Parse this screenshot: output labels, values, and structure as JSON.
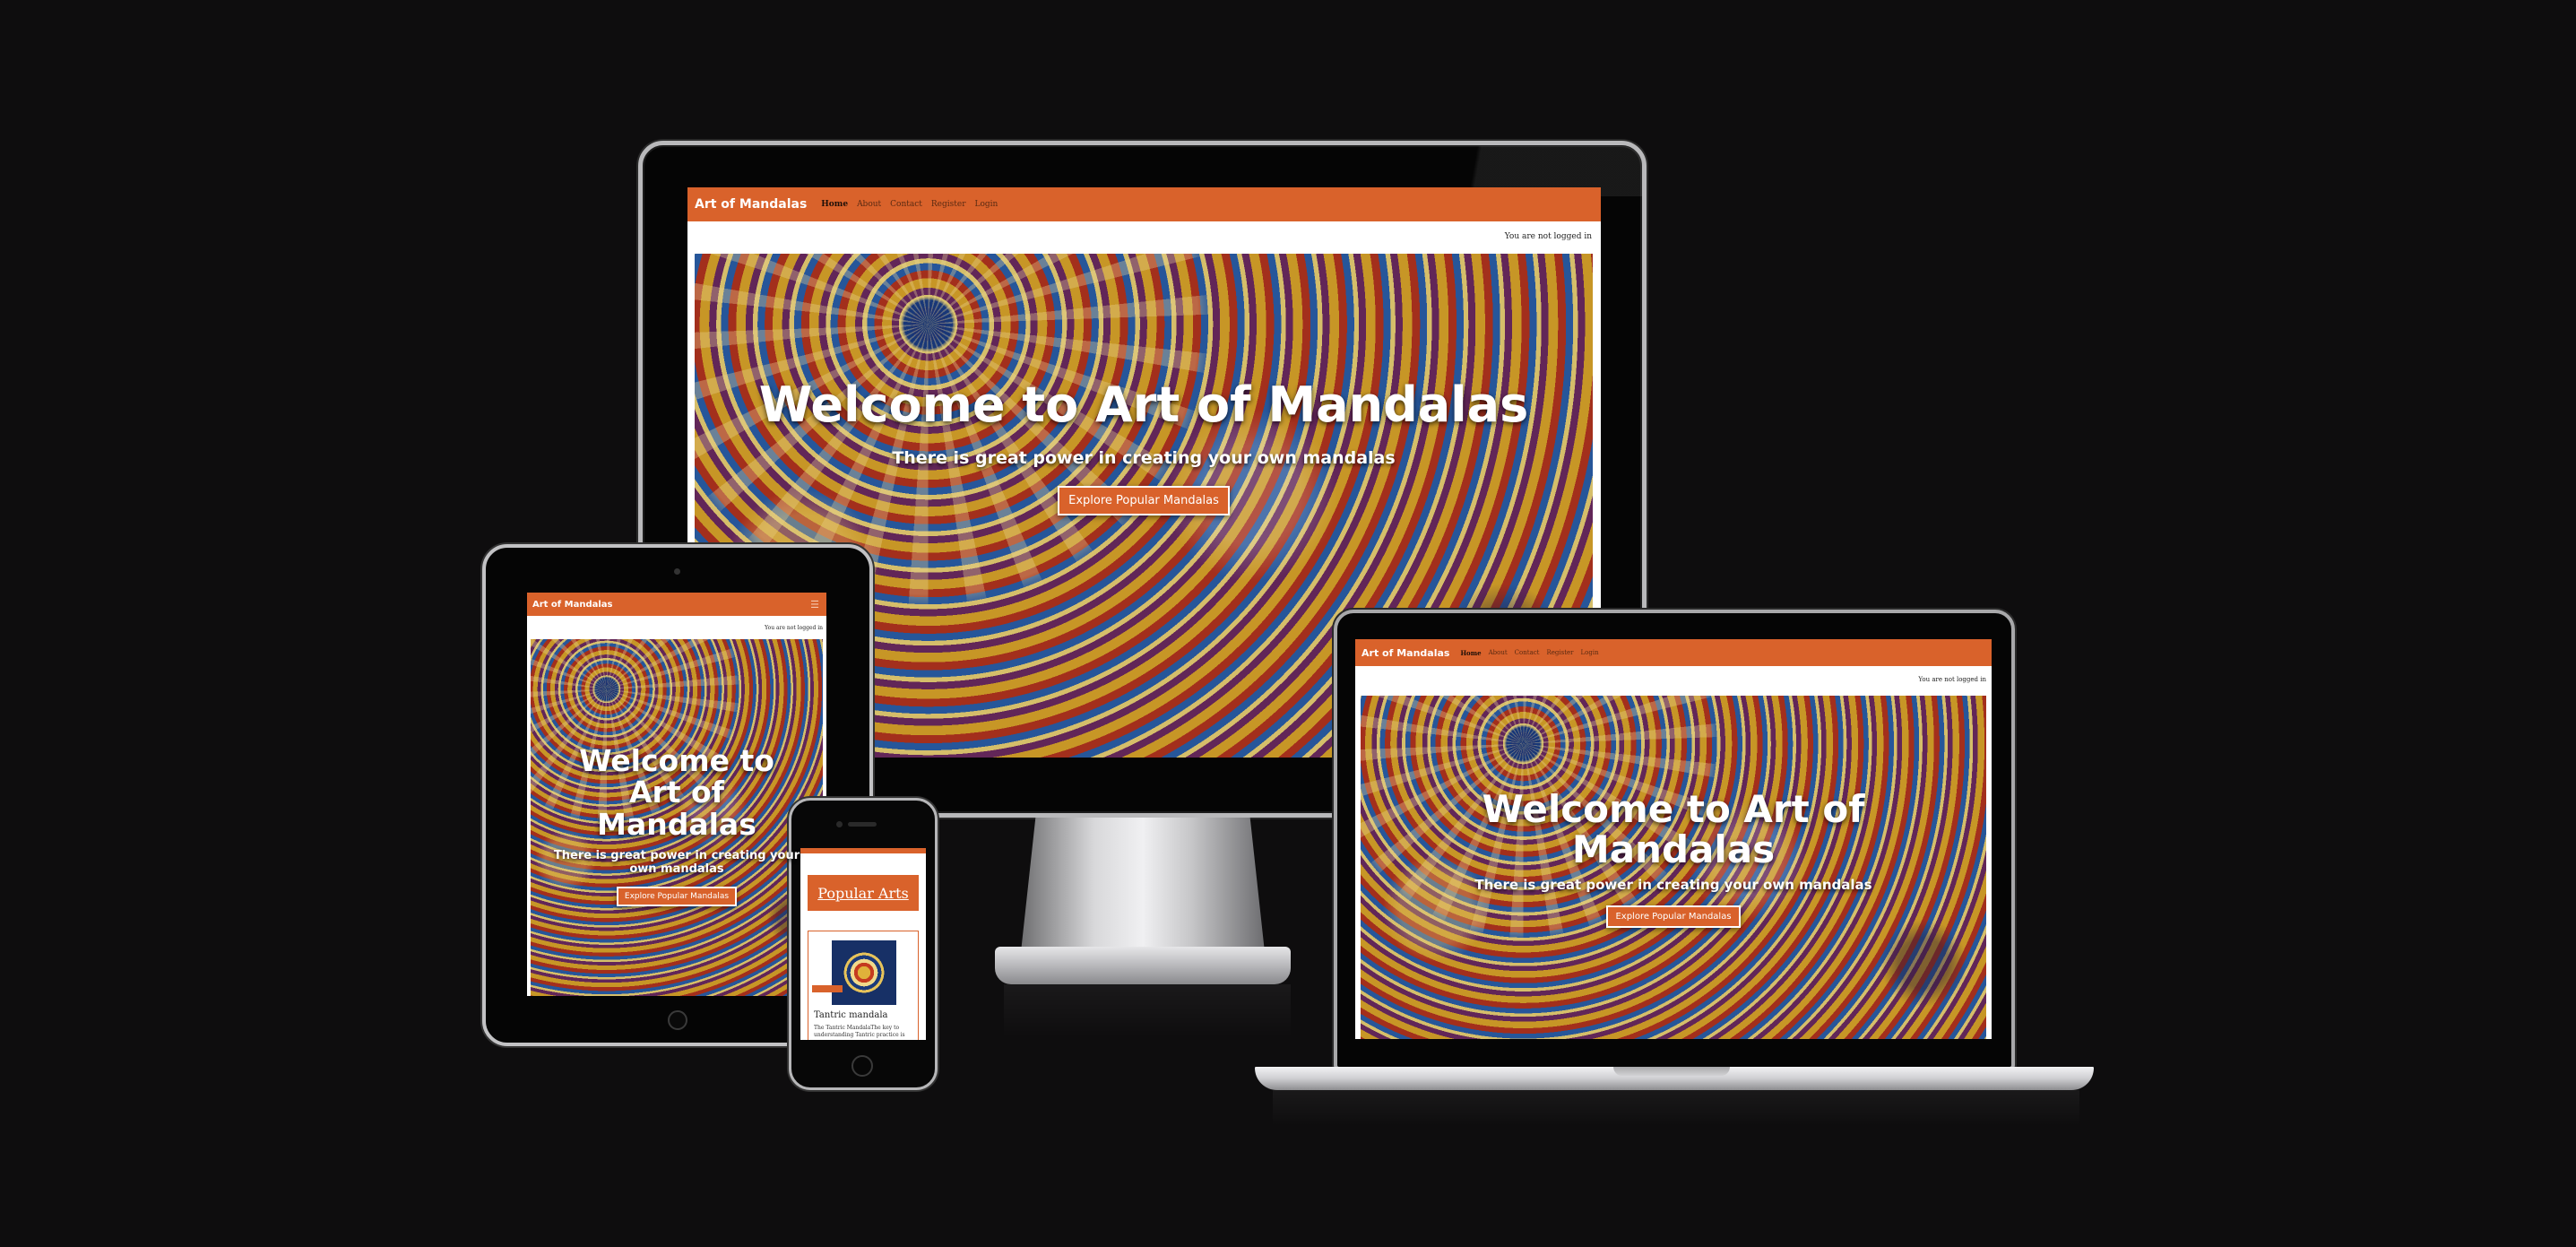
{
  "site": {
    "brand": "Art of Mandalas",
    "nav": [
      "Home",
      "About",
      "Contact",
      "Register",
      "Login"
    ],
    "login_status": "You are not logged in",
    "hero": {
      "title": "Welcome to Art of Mandalas",
      "subtitle": "There is great power in creating your own mandalas",
      "button": "Explore Popular Mandalas"
    }
  },
  "tablet": {
    "title_lines": [
      "Welcome to",
      "Art of",
      "Mandalas"
    ],
    "subtitle_lines": [
      "There is great power in creating your",
      "own mandalas"
    ],
    "menu_icon": "hamburger-icon"
  },
  "laptop": {
    "title_lines": [
      "Welcome to Art of",
      "Mandalas"
    ]
  },
  "phone": {
    "heading": "Popular Arts",
    "card_title": "Tantric mandala",
    "card_text": "The Tantric MandalaThe key to understanding Tantric practice is"
  },
  "colors": {
    "accent": "#d9622b",
    "background": "#0e0d0e"
  }
}
